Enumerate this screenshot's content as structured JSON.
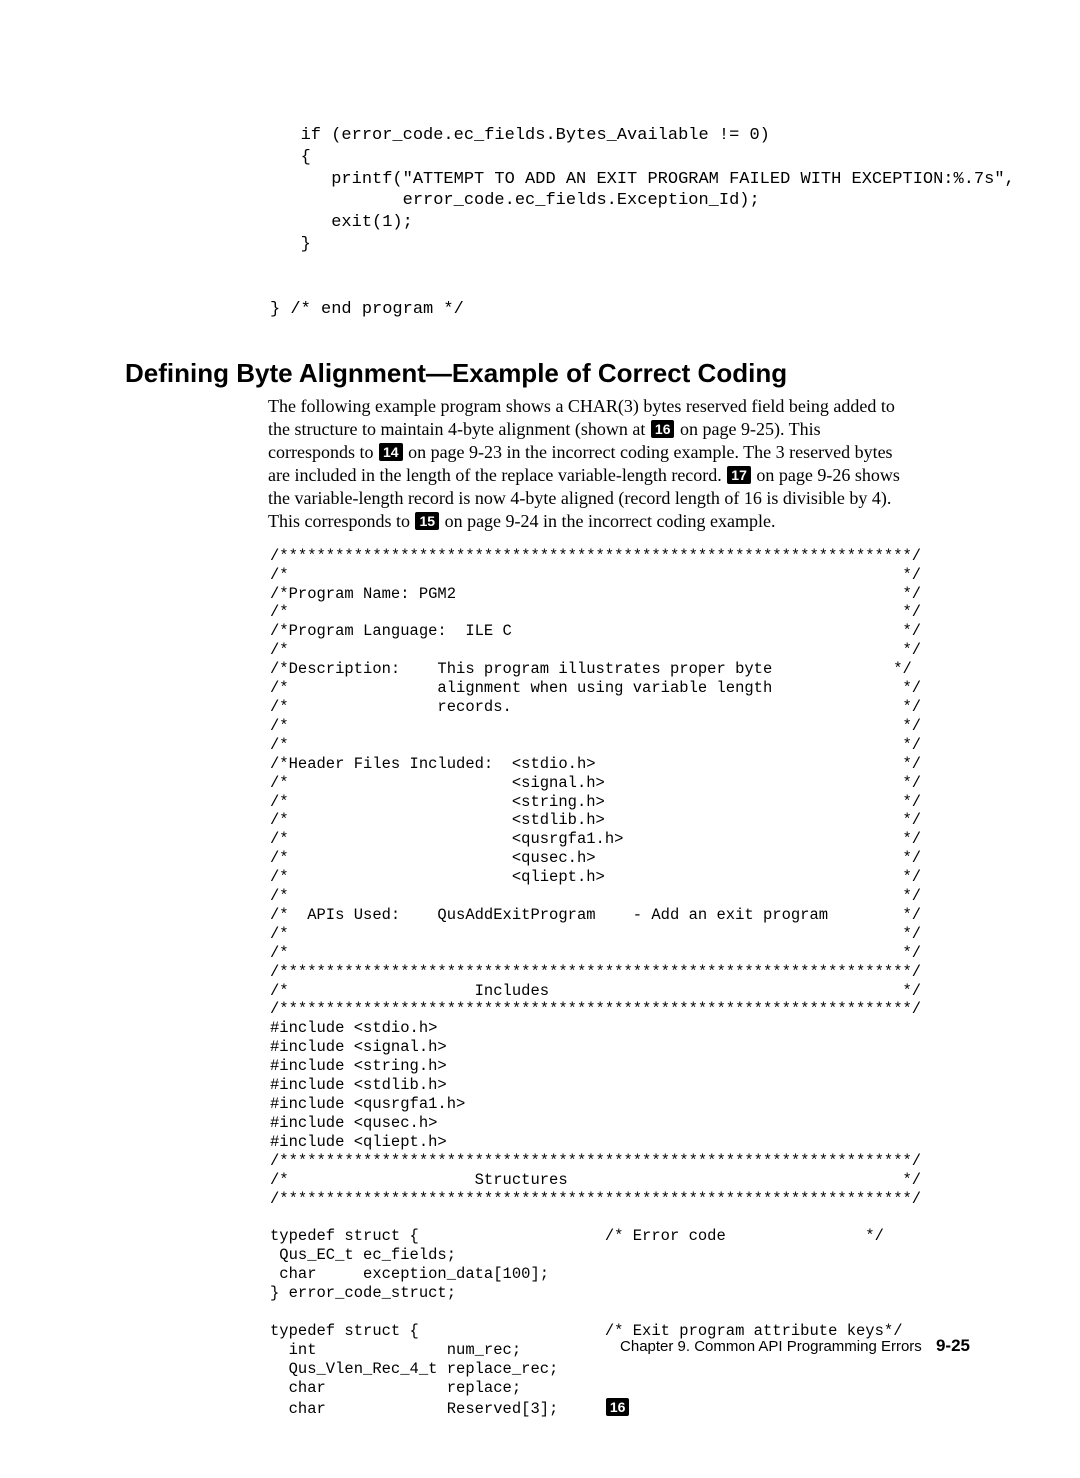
{
  "code_top": "   if (error_code.ec_fields.Bytes_Available != 0)\n   {\n      printf(\"ATTEMPT TO ADD AN EXIT PROGRAM FAILED WITH EXCEPTION:%.7s\",\n             error_code.ec_fields.Exception_Id);\n      exit(1);\n   }\n\n\n} /* end program */",
  "heading": "Defining Byte Alignment—Example of Correct Coding",
  "para": {
    "p1a": "The following example program shows a CHAR(3) bytes reserved field being added to the structure to maintain 4-byte alignment (shown at ",
    "c16": "16",
    "p1b": " on page 9-25).  This corresponds to ",
    "c14": "14",
    "p1c": " on page 9-23 in the incorrect coding example.  The 3 reserved bytes are included in the length of the replace variable-length record.   ",
    "c17": "17",
    "p1d": " on page 9-26 shows the variable-length record is now 4-byte aligned (record length of 16 is divisible by 4).  This corresponds to ",
    "c15": "15",
    "p1e": " on page 9-24 in the incorrect coding example."
  },
  "code_mid_a": "/********************************************************************/\n/*                                                                  */\n/*Program Name: PGM2                                                */\n/*                                                                  */\n/*Program Language:  ILE C                                          */\n/*                                                                  */\n/*Description:    This program illustrates proper byte             */\n/*                alignment when using variable length              */\n/*                records.                                          */\n/*                                                                  */\n/*                                                                  */\n/*Header Files Included:  <stdio.h>                                 */\n/*                        <signal.h>                                */\n/*                        <string.h>                                */\n/*                        <stdlib.h>                                */\n/*                        <qusrgfa1.h>                              */\n/*                        <qusec.h>                                 */\n/*                        <qliept.h>                                */\n/*                                                                  */\n/*  APIs Used:    QusAddExitProgram    - Add an exit program        */\n/*                                                                  */\n/*                                                                  */\n/********************************************************************/\n/*                    Includes                                      */\n/********************************************************************/\n#include <stdio.h>\n#include <signal.h>\n#include <string.h>\n#include <stdlib.h>\n#include <qusrgfa1.h>\n#include <qusec.h>\n#include <qliept.h>\n/********************************************************************/\n/*                    Structures                                    */\n/********************************************************************/\n\ntypedef struct {                    /* Error code               */\n Qus_EC_t ec_fields;\n char     exception_data[100];\n} error_code_struct;\n\ntypedef struct {                    /* Exit program attribute keys*/\n  int              num_rec;\n  Qus_Vlen_Rec_4_t replace_rec;\n  char             replace;\n  char             Reserved[3];     ",
  "footer_chapter": "Chapter 9.  Common API Programming Errors",
  "footer_page": "9-25"
}
